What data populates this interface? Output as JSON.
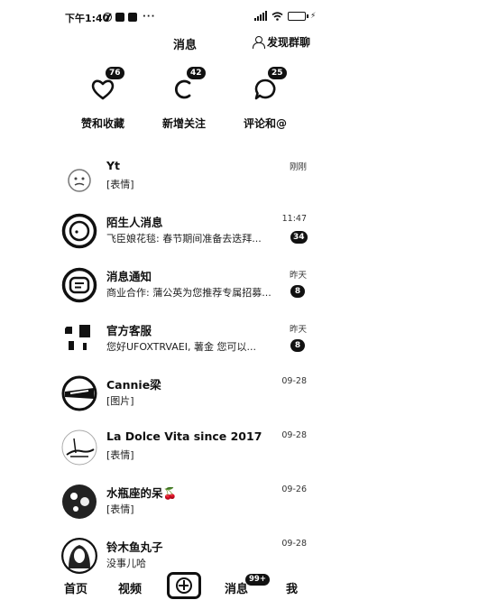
{
  "status_bar": {
    "time": "下午1:40",
    "dots": "···"
  },
  "header": {
    "title": "消息",
    "discover_label": "发现群聊"
  },
  "quick_actions": [
    {
      "label": "赞和收藏",
      "badge": "76",
      "icon": "heart-icon"
    },
    {
      "label": "新增关注",
      "badge": "42",
      "icon": "follow-icon"
    },
    {
      "label": "评论和@",
      "badge": "25",
      "icon": "comment-bubble-icon"
    }
  ],
  "messages": [
    {
      "name": "Yt",
      "preview": "[表情]",
      "time": "刚刚",
      "badge": ""
    },
    {
      "name": "陌生人消息",
      "preview": "飞臣娘花毯: 春节期间准备去迭拜...",
      "time": "11:47",
      "badge": "34"
    },
    {
      "name": "消息通知",
      "preview": "商业合作: 蒲公英为您推荐专属招募...",
      "time": "昨天",
      "badge": "8"
    },
    {
      "name": "官方客服",
      "preview": "您好UFOXTRVAEI, 薯金 您可以...",
      "time": "昨天",
      "badge": "8"
    },
    {
      "name": "Cannie梁",
      "preview": "[图片]",
      "time": "09-28",
      "badge": ""
    },
    {
      "name": "La Dolce Vita since 2017",
      "preview": "[表情]",
      "time": "09-28",
      "badge": ""
    },
    {
      "name": "水瓶座的呆🍒",
      "preview": "[表情]",
      "time": "09-26",
      "badge": ""
    },
    {
      "name": "铃木鱼丸子",
      "preview": "没事儿哈",
      "time": "09-28",
      "badge": ""
    }
  ],
  "bottom_nav": {
    "home": "首页",
    "video": "视频",
    "messages": "消息",
    "messages_badge": "99+",
    "me": "我"
  }
}
